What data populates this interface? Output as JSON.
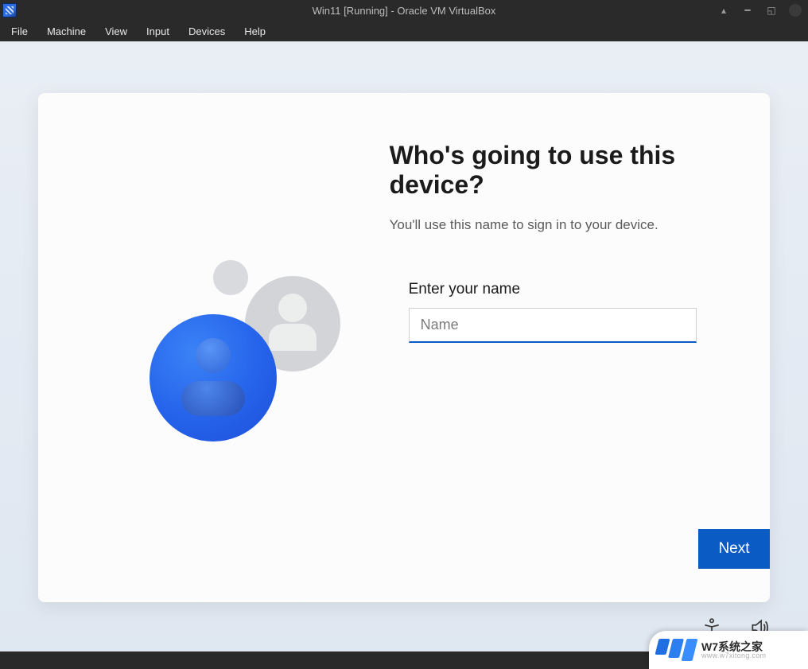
{
  "titlebar": {
    "title": "Win11 [Running] - Oracle VM VirtualBox"
  },
  "menubar": {
    "items": [
      "File",
      "Machine",
      "View",
      "Input",
      "Devices",
      "Help"
    ]
  },
  "oobe": {
    "heading": "Who's going to use this device?",
    "subtext": "You'll use this name to sign in to your device.",
    "field_label": "Enter your name",
    "name_placeholder": "Name",
    "name_value": "",
    "next_label": "Next"
  },
  "oobe_tray": {
    "accessibility_icon": "accessibility-icon",
    "volume_icon": "volume-icon"
  },
  "statusbar_icons": [
    "hard-disk-icon",
    "optical-disk-icon",
    "audio-icon",
    "network-icon",
    "usb-icon",
    "shared-folder-icon",
    "display-icon",
    "recording-icon",
    "guest-additions-icon"
  ],
  "watermark": {
    "line1": "W7系统之家",
    "line2": "www.w7xitong.com"
  },
  "colors": {
    "accent": "#0a5bc4",
    "titlebar_bg": "#2a2a2a",
    "guest_bg_top": "#e9eef5"
  }
}
